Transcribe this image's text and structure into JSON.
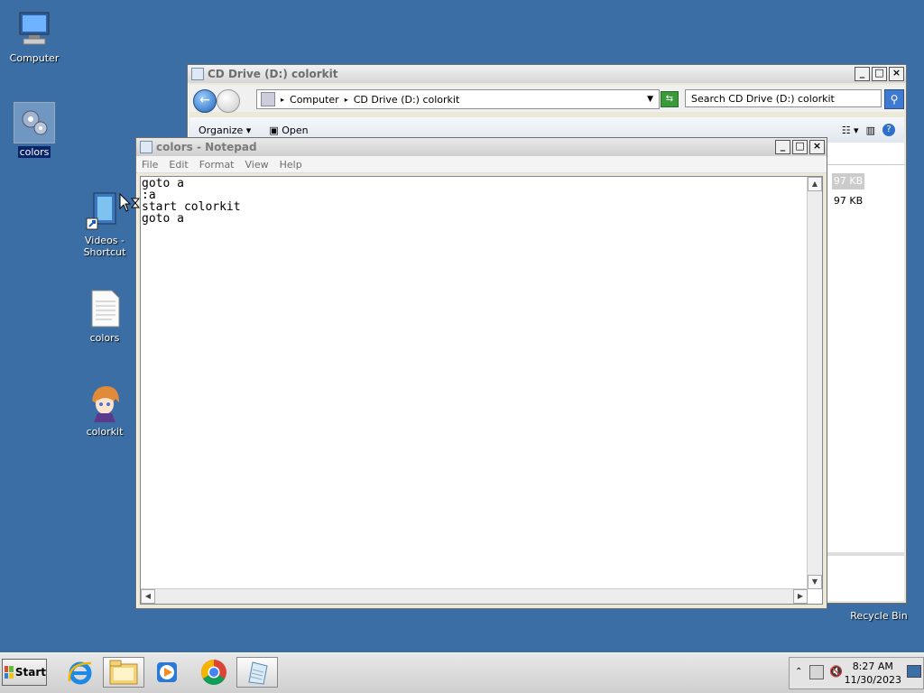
{
  "desktop": {
    "icons": [
      {
        "label": "Computer"
      },
      {
        "label": "colors"
      },
      {
        "label": "Videos - Shortcut"
      },
      {
        "label": "colors"
      },
      {
        "label": "colorkit"
      },
      {
        "label": "Recycle Bin"
      }
    ]
  },
  "explorer": {
    "title": "CD Drive (D:) colorkit",
    "breadcrumb": [
      "Computer",
      "CD Drive (D:) colorkit"
    ],
    "search_placeholder": "Search CD Drive (D:) colorkit",
    "toolbar": {
      "organize": "Organize",
      "open": "Open"
    },
    "sizes": [
      "97 KB",
      "97 KB"
    ]
  },
  "notepad": {
    "title": "colors - Notepad",
    "menu": [
      "File",
      "Edit",
      "Format",
      "View",
      "Help"
    ],
    "content": "goto a\n:a\nstart colorkit\ngoto a"
  },
  "taskbar": {
    "start_label": "Start",
    "apps": [
      "internet-explorer",
      "file-explorer",
      "media-player",
      "chrome",
      "notepad"
    ],
    "clock": {
      "time": "8:27 AM",
      "date": "11/30/2023"
    }
  },
  "colors": {
    "desktop": "#3a6ea5",
    "selection": "#0a246a"
  }
}
